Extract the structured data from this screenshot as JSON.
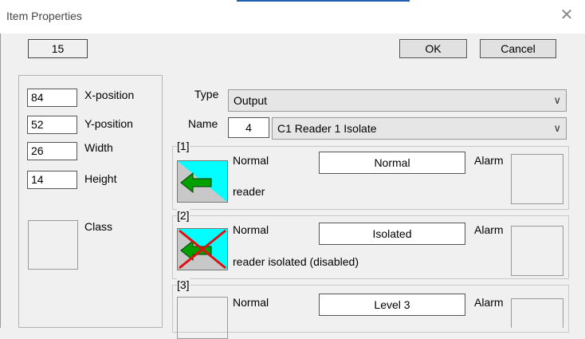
{
  "window": {
    "title": "Item Properties"
  },
  "header": {
    "item_number": "15",
    "ok_label": "OK",
    "cancel_label": "Cancel"
  },
  "geometry_fields": [
    {
      "value": "84",
      "label": "X-position"
    },
    {
      "value": "52",
      "label": "Y-position"
    },
    {
      "value": "26",
      "label": "Width"
    },
    {
      "value": "14",
      "label": "Height"
    }
  ],
  "class_label": "Class",
  "type": {
    "label": "Type",
    "value": "Output"
  },
  "name": {
    "label": "Name",
    "number": "4",
    "value": "C1 Reader 1 Isolate"
  },
  "states": [
    {
      "group_label": "[1]",
      "normal_label": "Normal",
      "state_value": "Normal",
      "alarm_label": "Alarm",
      "description": "reader"
    },
    {
      "group_label": "[2]",
      "normal_label": "Normal",
      "state_value": "Isolated",
      "alarm_label": "Alarm",
      "description": "reader isolated (disabled)"
    },
    {
      "group_label": "[3]",
      "normal_label": "Normal",
      "state_value": "Level 3",
      "alarm_label": "Alarm",
      "description": ""
    }
  ],
  "colors": {
    "icon_cyan": "#00ffff",
    "icon_arrow": "#00a000",
    "icon_cross": "#e01010",
    "title_accent": "#1f5fb0"
  },
  "icons": {
    "close": "close-icon",
    "dropdown": "chevron-down-icon",
    "state1": "reader-normal-icon",
    "state2": "reader-isolated-icon"
  }
}
